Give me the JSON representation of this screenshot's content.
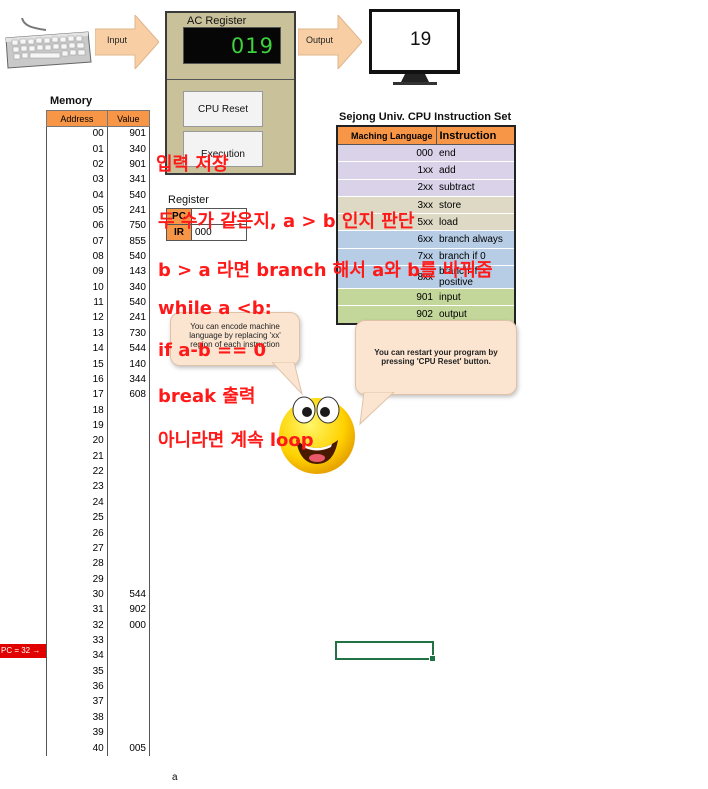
{
  "io": {
    "input_label": "Input",
    "output_label": "Output",
    "output_value": "19"
  },
  "ac_register": {
    "title": "AC Register",
    "display_value": "019",
    "cpu_reset_label": "CPU Reset",
    "execution_label": "Execution"
  },
  "memory": {
    "title": "Memory",
    "headers": [
      "Address",
      "Value"
    ],
    "rows": [
      [
        "00",
        "901"
      ],
      [
        "01",
        "340"
      ],
      [
        "02",
        "901"
      ],
      [
        "03",
        "341"
      ],
      [
        "04",
        "540"
      ],
      [
        "05",
        "241"
      ],
      [
        "06",
        "750"
      ],
      [
        "07",
        "855"
      ],
      [
        "08",
        "540"
      ],
      [
        "09",
        "143"
      ],
      [
        "10",
        "340"
      ],
      [
        "11",
        "540"
      ],
      [
        "12",
        "241"
      ],
      [
        "13",
        "730"
      ],
      [
        "14",
        "544"
      ],
      [
        "15",
        "140"
      ],
      [
        "16",
        "344"
      ],
      [
        "17",
        "608"
      ],
      [
        "18",
        ""
      ],
      [
        "19",
        ""
      ],
      [
        "20",
        ""
      ],
      [
        "21",
        ""
      ],
      [
        "22",
        ""
      ],
      [
        "23",
        ""
      ],
      [
        "24",
        ""
      ],
      [
        "25",
        ""
      ],
      [
        "26",
        ""
      ],
      [
        "27",
        ""
      ],
      [
        "28",
        ""
      ],
      [
        "29",
        ""
      ],
      [
        "30",
        "544"
      ],
      [
        "31",
        "902"
      ],
      [
        "32",
        "000"
      ],
      [
        "33",
        ""
      ],
      [
        "34",
        ""
      ],
      [
        "35",
        ""
      ],
      [
        "36",
        ""
      ],
      [
        "37",
        ""
      ],
      [
        "38",
        ""
      ],
      [
        "39",
        ""
      ],
      [
        "40",
        "005"
      ]
    ],
    "pc_marker": "PC = 32 →"
  },
  "register": {
    "title": "Register",
    "pc_label": "PC",
    "pc_value": "",
    "ir_label": "IR",
    "ir_value": "000"
  },
  "instruction_set": {
    "title": "Sejong Univ. CPU Instruction Set",
    "headers": [
      "Maching Language",
      "Instruction"
    ],
    "rows": [
      {
        "code": "000",
        "name": "end",
        "color": "#d9d2e9"
      },
      {
        "code": "1xx",
        "name": "add",
        "color": "#d9d2e9"
      },
      {
        "code": "2xx",
        "name": "subtract",
        "color": "#d9d2e9"
      },
      {
        "code": "3xx",
        "name": "store",
        "color": "#ddd9c4"
      },
      {
        "code": "5xx",
        "name": "load",
        "color": "#ddd9c4"
      },
      {
        "code": "6xx",
        "name": "branch always",
        "color": "#b7cde6"
      },
      {
        "code": "7xx",
        "name": "branch if 0",
        "color": "#b7cde6"
      },
      {
        "code": "8xx",
        "name": "branch if positive",
        "color": "#b7cde6"
      },
      {
        "code": "901",
        "name": "input",
        "color": "#c4d79b"
      },
      {
        "code": "902",
        "name": "output",
        "color": "#c4d79b"
      }
    ]
  },
  "annotations": [
    "입력 저장",
    "두 수가 같은지, a > b 인지 판단",
    "b > a 라면 branch 해서 a와 b를 바꿔줌",
    "while a <b:",
    "if a-b == 0",
    "break 출력",
    "아니라면 계속 loop"
  ],
  "bubbles": {
    "left_text": "You can encode machine language by replacing 'xx' region of each instruction",
    "right_text": "You can restart your program by pressing 'CPU Reset' button."
  },
  "stray_text": "a",
  "colors": {
    "header_orange": "#f79646",
    "ac_panel": "#c8c19a",
    "display_green": "#3cd23c",
    "annotation_red": "#ff1a1a",
    "pc_marker_red": "#e00000",
    "bubble_fill": "#fbe5d0",
    "arrow_fill": "#f8cfa5"
  },
  "icons": [
    "keyboard-icon",
    "monitor-icon",
    "smiley-icon",
    "arrow-right-icon"
  ]
}
